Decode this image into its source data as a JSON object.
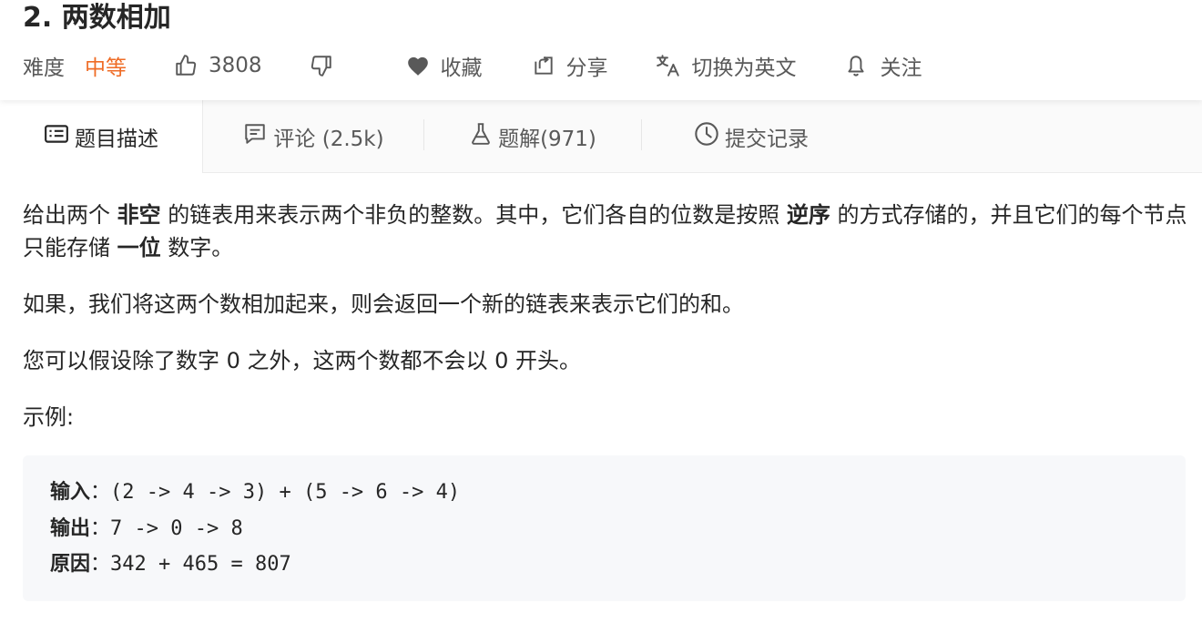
{
  "problem": {
    "title": "2. 两数相加",
    "difficulty_label": "难度",
    "difficulty_value": "中等",
    "likes": "3808",
    "favorite_label": "收藏",
    "share_label": "分享",
    "switch_lang_label": "切换为英文",
    "follow_label": "关注"
  },
  "tabs": [
    {
      "label": "题目描述",
      "icon": "description-icon"
    },
    {
      "label": "评论 (2.5k)",
      "icon": "comment-icon"
    },
    {
      "label": "题解(971)",
      "icon": "flask-icon"
    },
    {
      "label": "提交记录",
      "icon": "clock-icon"
    }
  ],
  "description": {
    "p1_a": "给出两个 ",
    "p1_b": "非空",
    "p1_c": " 的链表用来表示两个非负的整数。其中，它们各自的位数是按照 ",
    "p1_d": "逆序",
    "p1_e": " 的方式存储的，并且它们的每个节点只能存储 ",
    "p1_f": "一位",
    "p1_g": " 数字。",
    "p2": "如果，我们将这两个数相加起来，则会返回一个新的链表来表示它们的和。",
    "p3": "您可以假设除了数字 0 之外，这两个数都不会以 0 开头。",
    "example_heading": "示例:"
  },
  "example": {
    "input_label": "输入",
    "input_value": "(2 -> 4 -> 3) + (5 -> 6 -> 4)",
    "output_label": "输出",
    "output_value": "7 -> 0 -> 8",
    "reason_label": "原因",
    "reason_value": "342 + 465 = 807",
    "colon": "："
  },
  "colors": {
    "accent_orange": "#ef6c26",
    "text": "#262626",
    "muted": "#595959",
    "code_bg": "#f7f8fa"
  }
}
